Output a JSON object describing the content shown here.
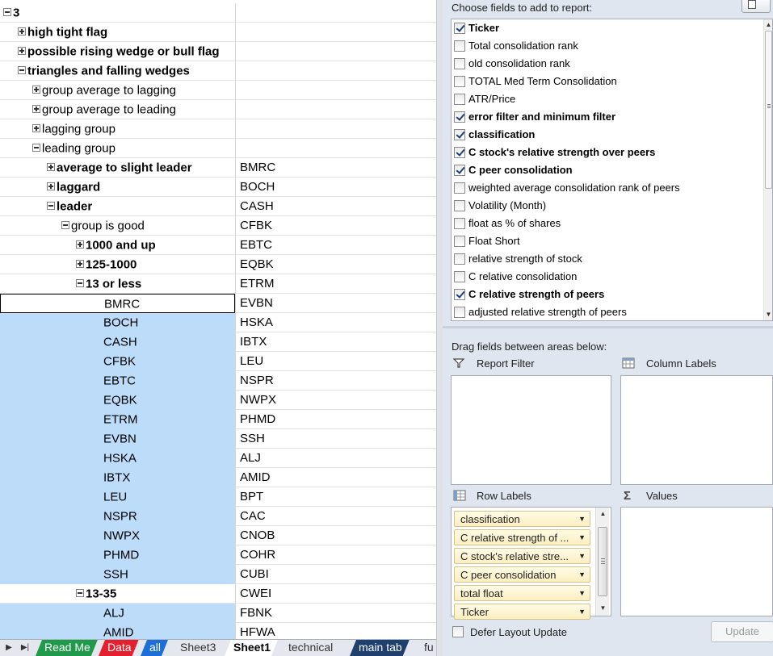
{
  "sheet": {
    "rows": [
      {
        "a": "3",
        "b": "",
        "indent": 0,
        "toggle": "minus",
        "bold": true,
        "style": ""
      },
      {
        "a": "high tight flag",
        "b": "",
        "indent": 1,
        "toggle": "plus",
        "bold": true,
        "style": ""
      },
      {
        "a": "possible rising wedge or bull flag",
        "b": "",
        "indent": 1,
        "toggle": "plus",
        "bold": true,
        "style": ""
      },
      {
        "a": "triangles and falling wedges",
        "b": "",
        "indent": 1,
        "toggle": "minus",
        "bold": true,
        "style": ""
      },
      {
        "a": "group average to lagging",
        "b": "",
        "indent": 2,
        "toggle": "plus",
        "bold": false,
        "style": ""
      },
      {
        "a": "group average to leading",
        "b": "",
        "indent": 2,
        "toggle": "plus",
        "bold": false,
        "style": ""
      },
      {
        "a": "lagging group",
        "b": "",
        "indent": 2,
        "toggle": "plus",
        "bold": false,
        "style": ""
      },
      {
        "a": "leading group",
        "b": "",
        "indent": 2,
        "toggle": "minus",
        "bold": false,
        "style": ""
      },
      {
        "a": "average to slight leader",
        "b": "BMRC",
        "indent": 3,
        "toggle": "plus",
        "bold": true,
        "style": ""
      },
      {
        "a": "laggard",
        "b": "BOCH",
        "indent": 3,
        "toggle": "plus",
        "bold": true,
        "style": ""
      },
      {
        "a": "leader",
        "b": "CASH",
        "indent": 3,
        "toggle": "minus",
        "bold": true,
        "style": ""
      },
      {
        "a": "group is good",
        "b": "CFBK",
        "indent": 4,
        "toggle": "minus",
        "bold": false,
        "style": ""
      },
      {
        "a": "1000 and up",
        "b": "EBTC",
        "indent": 5,
        "toggle": "plus",
        "bold": true,
        "style": ""
      },
      {
        "a": "125-1000",
        "b": "EQBK",
        "indent": 5,
        "toggle": "plus",
        "bold": true,
        "style": ""
      },
      {
        "a": "13 or less",
        "b": "ETRM",
        "indent": 5,
        "toggle": "minus",
        "bold": true,
        "style": ""
      },
      {
        "a": "BMRC",
        "b": "EVBN",
        "indent": 6,
        "toggle": "",
        "bold": false,
        "style": "active"
      },
      {
        "a": "BOCH",
        "b": "HSKA",
        "indent": 6,
        "toggle": "",
        "bold": false,
        "style": "sel"
      },
      {
        "a": "CASH",
        "b": "IBTX",
        "indent": 6,
        "toggle": "",
        "bold": false,
        "style": "sel"
      },
      {
        "a": "CFBK",
        "b": "LEU",
        "indent": 6,
        "toggle": "",
        "bold": false,
        "style": "sel"
      },
      {
        "a": "EBTC",
        "b": "NSPR",
        "indent": 6,
        "toggle": "",
        "bold": false,
        "style": "sel"
      },
      {
        "a": "EQBK",
        "b": "NWPX",
        "indent": 6,
        "toggle": "",
        "bold": false,
        "style": "sel"
      },
      {
        "a": "ETRM",
        "b": "PHMD",
        "indent": 6,
        "toggle": "",
        "bold": false,
        "style": "sel"
      },
      {
        "a": "EVBN",
        "b": "SSH",
        "indent": 6,
        "toggle": "",
        "bold": false,
        "style": "sel"
      },
      {
        "a": "HSKA",
        "b": "ALJ",
        "indent": 6,
        "toggle": "",
        "bold": false,
        "style": "sel"
      },
      {
        "a": "IBTX",
        "b": "AMID",
        "indent": 6,
        "toggle": "",
        "bold": false,
        "style": "sel"
      },
      {
        "a": "LEU",
        "b": "BPT",
        "indent": 6,
        "toggle": "",
        "bold": false,
        "style": "sel"
      },
      {
        "a": "NSPR",
        "b": "CAC",
        "indent": 6,
        "toggle": "",
        "bold": false,
        "style": "sel"
      },
      {
        "a": "NWPX",
        "b": "CNOB",
        "indent": 6,
        "toggle": "",
        "bold": false,
        "style": "sel"
      },
      {
        "a": "PHMD",
        "b": "COHR",
        "indent": 6,
        "toggle": "",
        "bold": false,
        "style": "sel"
      },
      {
        "a": "SSH",
        "b": "CUBI",
        "indent": 6,
        "toggle": "",
        "bold": false,
        "style": "sel"
      },
      {
        "a": "13-35",
        "b": "CWEI",
        "indent": 5,
        "toggle": "minus",
        "bold": true,
        "style": ""
      },
      {
        "a": "ALJ",
        "b": "FBNK",
        "indent": 6,
        "toggle": "",
        "bold": false,
        "style": "sel"
      },
      {
        "a": "AMID",
        "b": "HFWA",
        "indent": 6,
        "toggle": "",
        "bold": false,
        "style": "sel"
      }
    ]
  },
  "tabs": [
    {
      "label": "Read Me",
      "bg": "#1f9a4a",
      "fg": "#ffffff",
      "bold": false
    },
    {
      "label": "Data",
      "bg": "#e5202e",
      "fg": "#ffffff",
      "bold": false
    },
    {
      "label": "all",
      "bg": "#1c6fd6",
      "fg": "#ffffff",
      "bold": false
    },
    {
      "label": "Sheet3",
      "bg": "#e4e8ee",
      "fg": "#333333",
      "bold": false
    },
    {
      "label": "Sheet1",
      "bg": "#ffffff",
      "fg": "#000000",
      "bold": true
    },
    {
      "label": "technical",
      "bg": "#e4e8ee",
      "fg": "#333333",
      "bold": false
    },
    {
      "label": "main tab",
      "bg": "#1f3f6e",
      "fg": "#ffffff",
      "bold": false
    },
    {
      "label": "fu",
      "bg": "#e4e8ee",
      "fg": "#333333",
      "bold": false
    }
  ],
  "pane": {
    "choose_label": "Choose fields to add to report:",
    "fields": [
      {
        "label": "Ticker",
        "checked": true
      },
      {
        "label": "Total consolidation rank",
        "checked": false
      },
      {
        "label": "old consolidation rank",
        "checked": false
      },
      {
        "label": "TOTAL Med Term Consolidation",
        "checked": false
      },
      {
        "label": "ATR/Price",
        "checked": false
      },
      {
        "label": "error filter and minimum filter",
        "checked": true
      },
      {
        "label": "classification",
        "checked": true
      },
      {
        "label": "C stock's relative strength over peers",
        "checked": true
      },
      {
        "label": "C peer consolidation",
        "checked": true
      },
      {
        "label": "weighted average consolidation rank of peers",
        "checked": false
      },
      {
        "label": "Volatility (Month)",
        "checked": false
      },
      {
        "label": "float as % of shares",
        "checked": false
      },
      {
        "label": "Float Short",
        "checked": false
      },
      {
        "label": "relative strength of stock",
        "checked": false
      },
      {
        "label": "C relative consolidation",
        "checked": false
      },
      {
        "label": "C relative strength of peers",
        "checked": true
      },
      {
        "label": "adjusted relative strength of peers",
        "checked": false
      }
    ],
    "drag_label": "Drag fields between areas below:",
    "report_filter_label": "Report Filter",
    "column_labels_label": "Column Labels",
    "row_labels_label": "Row Labels",
    "values_label": "Values",
    "row_chips": [
      "classification",
      "C relative strength of ...",
      "C stock's relative stre...",
      "C peer consolidation",
      "total float",
      "Ticker"
    ],
    "defer_label": "Defer Layout Update",
    "update_label": "Update"
  }
}
